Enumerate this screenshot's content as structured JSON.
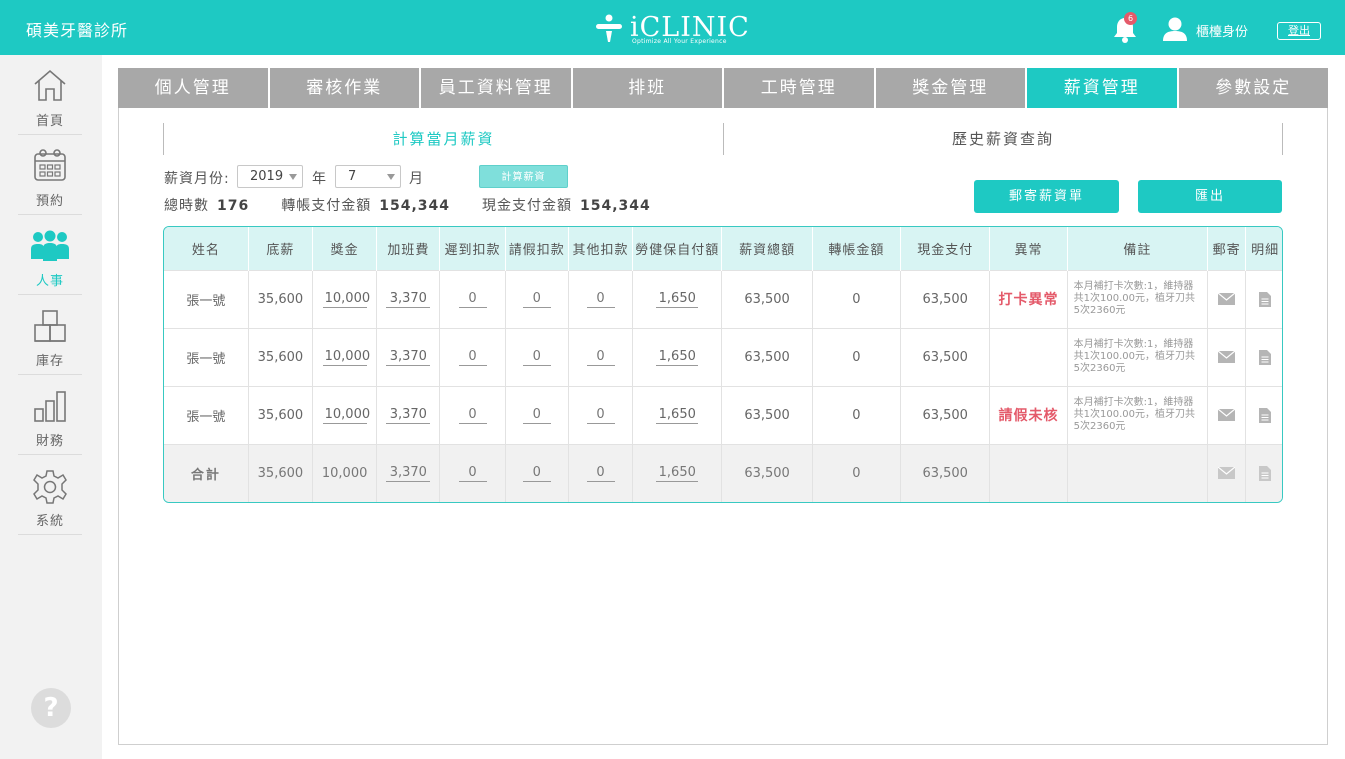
{
  "header": {
    "clinic_name": "碩美牙醫診所",
    "logo_text": "iCLINIC",
    "logo_tagline": "Optimize All Your Experience",
    "notification_count": "6",
    "user_role": "櫃檯身份",
    "logout_label": "登出"
  },
  "sidebar": {
    "items": [
      {
        "label": "首頁",
        "icon": "home-icon"
      },
      {
        "label": "預約",
        "icon": "calendar-icon"
      },
      {
        "label": "人事",
        "icon": "people-icon"
      },
      {
        "label": "庫存",
        "icon": "boxes-icon"
      },
      {
        "label": "財務",
        "icon": "bar-chart-icon"
      },
      {
        "label": "系統",
        "icon": "gear-icon"
      }
    ],
    "active": "人事",
    "help_label": "?"
  },
  "tabs": [
    "個人管理",
    "審核作業",
    "員工資料管理",
    "排班",
    "工時管理",
    "獎金管理",
    "薪資管理",
    "參數設定"
  ],
  "active_tab": "薪資管理",
  "subtabs": [
    "計算當月薪資",
    "歷史薪資查詢"
  ],
  "form": {
    "month_label": "薪資月份:",
    "year_value": "2019",
    "year_unit": "年",
    "month_value": "7",
    "month_unit": "月",
    "calc_button": "計算薪資"
  },
  "summary": {
    "hours_label": "總時數",
    "hours_value": "176",
    "transfer_label": "轉帳支付金額",
    "transfer_value": "154,344",
    "cash_label": "現金支付金額",
    "cash_value": "154,344"
  },
  "buttons": {
    "mail_payslip": "郵寄薪資單",
    "export": "匯出"
  },
  "table": {
    "headers": [
      "姓名",
      "底薪",
      "獎金",
      "加班費",
      "遲到扣款",
      "請假扣款",
      "其他扣款",
      "勞健保自付額",
      "薪資總額",
      "轉帳金額",
      "現金支付",
      "異常",
      "備註",
      "郵寄",
      "明細"
    ],
    "rows": [
      {
        "name": "張一號",
        "base": "35,600",
        "bonus": "10,000",
        "overtime": "3,370",
        "late": "0",
        "leave": "0",
        "other": "0",
        "insurance": "1,650",
        "total": "63,500",
        "transfer": "0",
        "cash": "63,500",
        "abnormal": "打卡異常",
        "note": "本月補打卡次數:1，維持器共1次100.00元，植牙刀共5次2360元"
      },
      {
        "name": "張一號",
        "base": "35,600",
        "bonus": "10,000",
        "overtime": "3,370",
        "late": "0",
        "leave": "0",
        "other": "0",
        "insurance": "1,650",
        "total": "63,500",
        "transfer": "0",
        "cash": "63,500",
        "abnormal": "",
        "note": "本月補打卡次數:1，維持器共1次100.00元，植牙刀共5次2360元"
      },
      {
        "name": "張一號",
        "base": "35,600",
        "bonus": "10,000",
        "overtime": "3,370",
        "late": "0",
        "leave": "0",
        "other": "0",
        "insurance": "1,650",
        "total": "63,500",
        "transfer": "0",
        "cash": "63,500",
        "abnormal": "請假未核",
        "note": "本月補打卡次數:1，維持器共1次100.00元，植牙刀共5次2360元"
      }
    ],
    "total_row": {
      "name": "合計",
      "base": "35,600",
      "bonus": "10,000",
      "overtime": "3,370",
      "late": "0",
      "leave": "0",
      "other": "0",
      "insurance": "1,650",
      "total": "63,500",
      "transfer": "0",
      "cash": "63,500"
    }
  },
  "colors": {
    "brand": "#1ec9c3",
    "tab_inactive": "#a8a8a8",
    "alert": "#e45a6a",
    "table_header": "#d8f4f3"
  }
}
